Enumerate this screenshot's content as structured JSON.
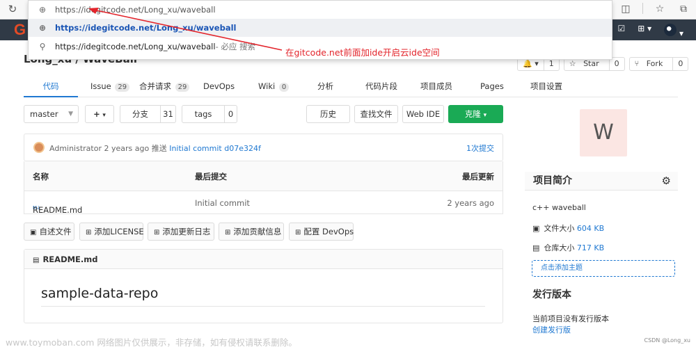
{
  "omnibox": {
    "input_url": "https://idegitcode.net/Long_xu/waveball",
    "suggestion_url": "https://idegitcode.net/Long_xu/waveball",
    "search_query": "https://idegitcode.net/Long_xu/waveball",
    "search_suffix": " - 必应 搜索"
  },
  "annotation": {
    "text": "在gitcode.net前面加ide开启云ide空间",
    "color": "#e3242b"
  },
  "project": {
    "title": "Long_xu / WaveBall",
    "star_label": "Star",
    "star_count": "0",
    "fork_label": "Fork",
    "fork_count": "0",
    "notify_count": "1"
  },
  "tabs": [
    {
      "label": "代码"
    },
    {
      "label": "Issue",
      "badge": "29"
    },
    {
      "label": "合并请求",
      "badge": "29"
    },
    {
      "label": "DevOps"
    },
    {
      "label": "Wiki",
      "badge": "0"
    },
    {
      "label": "分析"
    },
    {
      "label": "代码片段"
    },
    {
      "label": "项目成员"
    },
    {
      "label": "Pages"
    },
    {
      "label": "项目设置"
    }
  ],
  "controls": {
    "branch": "master",
    "plus": "+",
    "branch_label": "分支",
    "branch_count": "31",
    "tags_label": "tags",
    "tags_count": "0",
    "history": "历史",
    "find_file": "查找文件",
    "web_ide": "Web IDE",
    "clone": "克隆"
  },
  "commit": {
    "author": "Administrator",
    "time": "2 years ago",
    "pushed": "推送",
    "message": "Initial commit",
    "sha": "d07e324f",
    "count": "1次提交"
  },
  "file_table": {
    "col_name": "名称",
    "col_commit": "最后提交",
    "col_updated": "最后更新",
    "rows": [
      {
        "name": "README.md",
        "commit": "Initial commit",
        "updated": "2 years ago",
        "icon": "M↓"
      }
    ]
  },
  "add_buttons": [
    "自述文件",
    "添加LICENSE",
    "添加更新日志",
    "添加贡献信息",
    "配置 DevOps"
  ],
  "readme": {
    "header": "README.md",
    "heading": "sample-data-repo"
  },
  "sidebar": {
    "avatar_letter": "W",
    "intro_title": "项目简介",
    "description": "c++ waveball",
    "file_size_label": "文件大小",
    "file_size": "604 KB",
    "repo_size_label": "仓库大小",
    "repo_size": "717 KB",
    "add_topic": "点击添加主题",
    "release_title": "发行版本",
    "no_release": "当前项目没有发行版本",
    "create_release": "创建发行版"
  },
  "watermark": {
    "left": "www.toymoban.com 网络图片仅供展示，非存储，如有侵权请联系删除。",
    "right": "CSDN @Long_xu"
  },
  "colors": {
    "nav_bg": "#303a46",
    "brand": "#e44b26",
    "primary": "#1f78d1",
    "clone_green": "#1aaa55",
    "annotation": "#e3242b"
  }
}
